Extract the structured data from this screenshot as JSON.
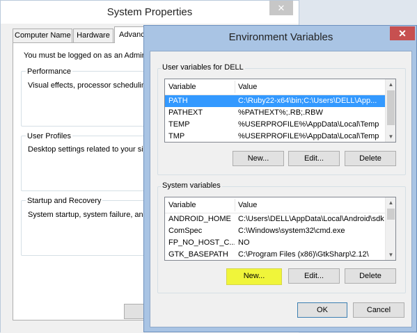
{
  "system_properties": {
    "title": "System Properties",
    "close_glyph": "✕",
    "tabs": [
      {
        "label": "Computer Name"
      },
      {
        "label": "Hardware"
      },
      {
        "label": "Advanc"
      }
    ],
    "notice": "You must be logged on as an Admini",
    "groups": {
      "performance": {
        "title": "Performance",
        "description": "Visual effects, processor scheduling"
      },
      "user_profiles": {
        "title": "User Profiles",
        "description": "Desktop settings related to your sig"
      },
      "startup": {
        "title": "Startup and Recovery",
        "description": "System startup, system failure, and d"
      }
    }
  },
  "env": {
    "title": "Environment Variables",
    "close_glyph": "✕",
    "user": {
      "label": "User variables for DELL",
      "columns": {
        "variable": "Variable",
        "value": "Value"
      },
      "rows": [
        {
          "variable": "PATH",
          "value": "C:\\Ruby22-x64\\bin;C:\\Users\\DELL\\App..."
        },
        {
          "variable": "PATHEXT",
          "value": "%PATHEXT%;.RB;.RBW"
        },
        {
          "variable": "TEMP",
          "value": "%USERPROFILE%\\AppData\\Local\\Temp"
        },
        {
          "variable": "TMP",
          "value": "%USERPROFILE%\\AppData\\Local\\Temp"
        }
      ],
      "buttons": {
        "new": "New...",
        "edit": "Edit...",
        "delete": "Delete"
      }
    },
    "system": {
      "label": "System variables",
      "columns": {
        "variable": "Variable",
        "value": "Value"
      },
      "rows": [
        {
          "variable": "ANDROID_HOME",
          "value": "C:\\Users\\DELL\\AppData\\Local\\Android\\sdk"
        },
        {
          "variable": "ComSpec",
          "value": "C:\\Windows\\system32\\cmd.exe"
        },
        {
          "variable": "FP_NO_HOST_C...",
          "value": "NO"
        },
        {
          "variable": "GTK_BASEPATH",
          "value": "C:\\Program Files (x86)\\GtkSharp\\2.12\\"
        }
      ],
      "buttons": {
        "new": "New...",
        "edit": "Edit...",
        "delete": "Delete"
      }
    },
    "ok": "OK",
    "cancel": "Cancel"
  },
  "scroll_glyphs": {
    "up": "▲",
    "down": "▼"
  },
  "colors": {
    "selection": "#3399ff",
    "highlight": "#f0f53a",
    "dialog_frame": "#a9c4e4",
    "close_red": "#c75050"
  }
}
